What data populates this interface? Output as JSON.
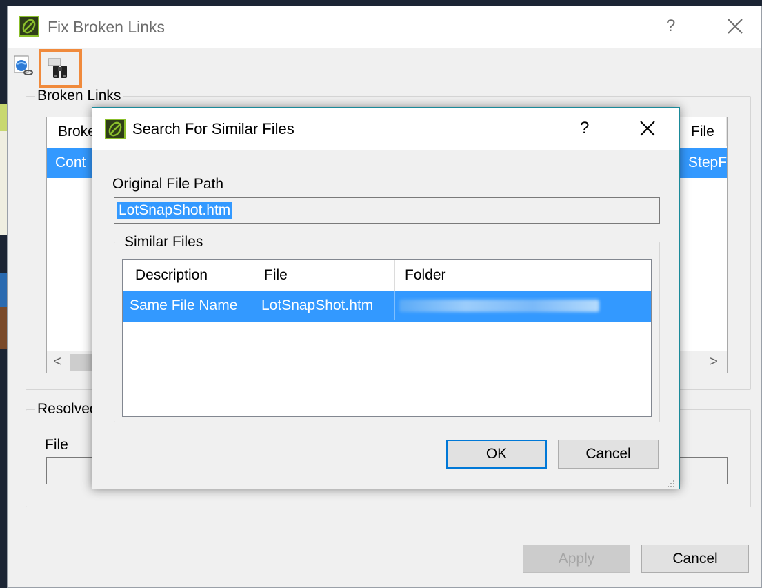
{
  "outer": {
    "title": "Fix Broken Links",
    "help_glyph": "?",
    "toolbar": {
      "tools": [
        {
          "icon": "globe-link-icon"
        },
        {
          "icon": "binoculars-search-icon",
          "highlighted": true
        }
      ]
    },
    "broken_links": {
      "legend": "Broken Links",
      "columns": [
        "Broke",
        "File"
      ],
      "row": {
        "col1": "Cont",
        "col2": "StepF"
      },
      "scroll_left": "<",
      "scroll_right": ">"
    },
    "resolved": {
      "legend": "Resolved",
      "file_label": "File",
      "file_value": ""
    },
    "buttons": {
      "apply": "Apply",
      "cancel": "Cancel"
    }
  },
  "search_dialog": {
    "title": "Search For Similar Files",
    "help_glyph": "?",
    "original_path_label": "Original File Path",
    "original_path_value": "LotSnapShot.htm",
    "similar_files": {
      "legend": "Similar Files",
      "columns": [
        "Description",
        "File",
        "Folder"
      ],
      "rows": [
        {
          "description": "Same File Name",
          "file": "LotSnapShot.htm",
          "folder": ""
        }
      ]
    },
    "buttons": {
      "ok": "OK",
      "cancel": "Cancel"
    }
  },
  "colors": {
    "selection": "#3399ff",
    "highlight_border": "#f08a3c",
    "inner_border": "#1a8a9a",
    "logo_green": "#8bbf2c"
  }
}
